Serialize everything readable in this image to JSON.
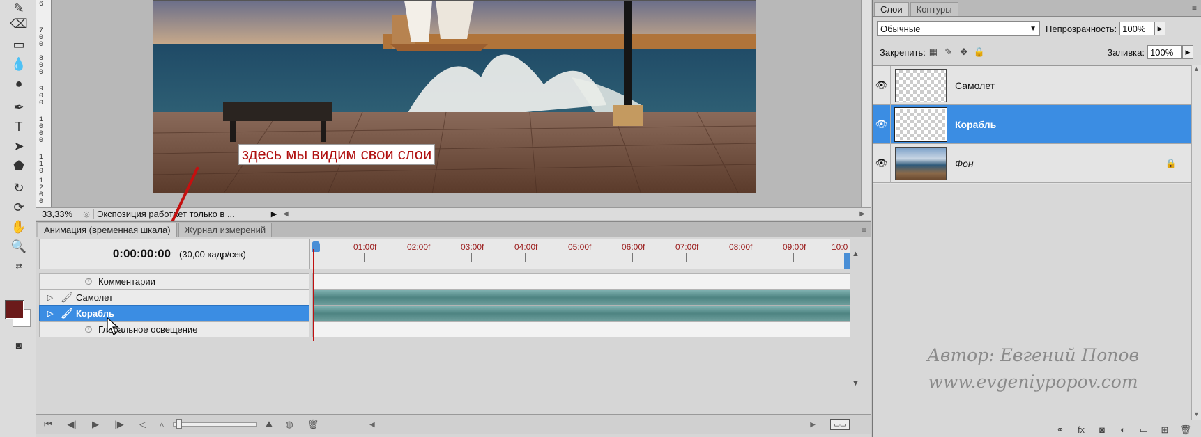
{
  "doc": {
    "zoom": "33,33%",
    "status_text": "Экспозиция работает только в ...",
    "ruler_marks": [
      "6",
      "7",
      "0",
      "0",
      "8",
      "0",
      "0",
      "9",
      "0",
      "0",
      "1",
      "0",
      "0",
      "0",
      "1",
      "1",
      "0",
      "1",
      "2",
      "0",
      "0"
    ]
  },
  "annotation": {
    "callout": "здесь мы видим свои слои"
  },
  "animation": {
    "tabs": [
      "Анимация (временная шкала)",
      "Журнал измерений"
    ],
    "current_time": "0:00:00:00",
    "fps": "(30,00 кадр/сек)",
    "time_ticks": [
      "01:00f",
      "02:00f",
      "03:00f",
      "04:00f",
      "05:00f",
      "06:00f",
      "07:00f",
      "08:00f",
      "09:00f",
      "10:0"
    ],
    "tracks": [
      {
        "name": "Комментарии",
        "kind": "comment"
      },
      {
        "name": "Самолет",
        "kind": "layer"
      },
      {
        "name": "Корабль",
        "kind": "layer",
        "selected": true
      },
      {
        "name": "Глобальное освещение",
        "kind": "global"
      }
    ]
  },
  "layers": {
    "tabs": [
      "Слои",
      "Контуры"
    ],
    "blend_mode": "Обычные",
    "opacity_label": "Непрозрачность:",
    "opacity_value": "100%",
    "lock_label": "Закрепить:",
    "fill_label": "Заливка:",
    "fill_value": "100%",
    "items": [
      {
        "name": "Самолет",
        "selected": false,
        "locked": false
      },
      {
        "name": "Корабль",
        "selected": true,
        "locked": false
      },
      {
        "name": "Фон",
        "selected": false,
        "locked": true
      }
    ]
  },
  "watermark": {
    "line1": "Автор: Евгений Попов",
    "line2": "www.evgeniypopov.com"
  },
  "colors": {
    "selection": "#3b8de3",
    "foreground": "#6b1a1a",
    "timebar": "#4e8482",
    "callout_text": "#b01010"
  }
}
